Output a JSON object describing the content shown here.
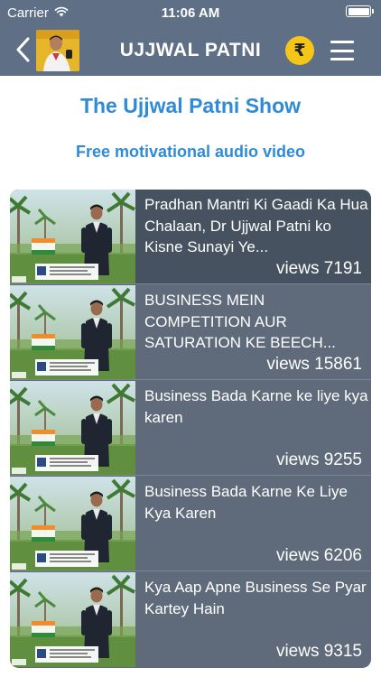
{
  "status_bar": {
    "carrier": "Carrier",
    "time": "11:06 AM"
  },
  "nav": {
    "title": "UJJWAL PATNI",
    "rupee_symbol": "₹"
  },
  "header": {
    "show_title": "The Ujjwal Patni Show",
    "subtitle": "Free motivational audio video"
  },
  "videos": [
    {
      "title": "Pradhan Mantri Ki Gaadi Ka Hua Chalaan, Dr Ujjwal Patni ko Kisne Sunayi Ye...",
      "views": "views 7191"
    },
    {
      "title": "BUSINESS MEIN COMPETITION AUR SATURATION KE BEECH...",
      "views": "views 15861"
    },
    {
      "title": "Business Bada Karne ke liye kya karen",
      "views": "views 9255"
    },
    {
      "title": "Business Bada Karne Ke Liye Kya Karen",
      "views": "views 6206"
    },
    {
      "title": "Kya Aap Apne Business Se Pyar Kartey Hain",
      "views": "views 9315"
    }
  ],
  "colors": {
    "bar": "#5f7086",
    "accent": "#2f8bd8",
    "list_bg": "#5f6b7a",
    "list_active": "#465260",
    "rupee": "#f5c518"
  },
  "icons": {
    "back": "chevron-left-icon",
    "rupee": "rupee-icon",
    "menu": "hamburger-menu-icon",
    "wifi": "wifi-icon",
    "battery": "battery-icon"
  }
}
